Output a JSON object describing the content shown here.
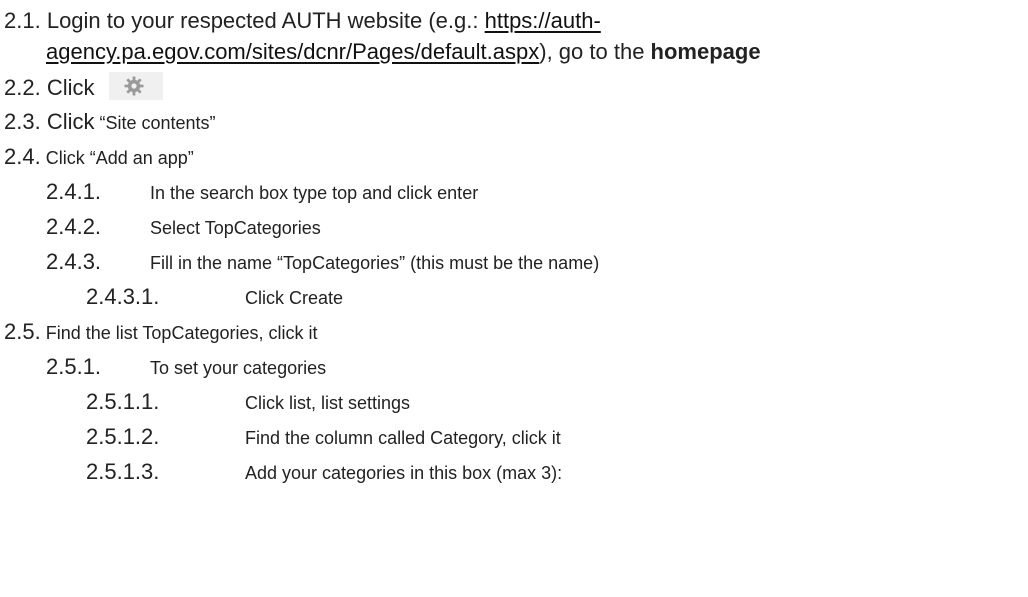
{
  "items": [
    {
      "num": "2.1.",
      "pre": "Login to your respected AUTH website (e.g.: ",
      "link1": "https://auth-"
    },
    {
      "link2": "agency.pa.egov.com/sites/dcnr/Pages/default.aspx",
      "mid": "), go to the ",
      "bold": "homepage"
    },
    {
      "num": "2.2.",
      "text": "Click",
      "icon": "gear-icon"
    },
    {
      "num": "2.3.",
      "pre": "Click",
      "text": " “Site contents”"
    },
    {
      "num": "2.4.",
      "text": " Click “Add an app”"
    },
    {
      "num": "2.4.1.",
      "text": "In the search box type top and click enter"
    },
    {
      "num": "2.4.2.",
      "text": "Select TopCategories"
    },
    {
      "num": "2.4.3.",
      "text": "Fill in the name “TopCategories” (this must be the name)"
    },
    {
      "num": "2.4.3.1.",
      "text": "Click Create"
    },
    {
      "num": "2.5.",
      "text": " Find the list TopCategories, click it"
    },
    {
      "num": "2.5.1.",
      "text": "To set your categories"
    },
    {
      "num": "2.5.1.1.",
      "text": "Click list, list settings"
    },
    {
      "num": "2.5.1.2.",
      "text": "Find the column called Category, click it"
    },
    {
      "num": "2.5.1.3.",
      "text": "Add your categories in this box (max 3):"
    }
  ]
}
